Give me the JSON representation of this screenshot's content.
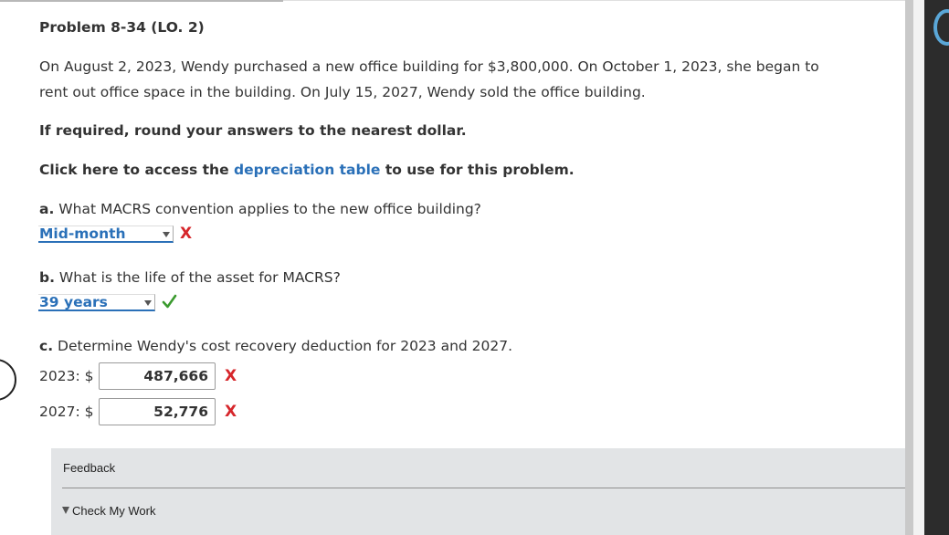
{
  "problem": {
    "title": "Problem 8-34 (LO. 2)",
    "intro_line1": "On August 2, 2023, Wendy purchased a new office building for $3,800,000. On October 1, 2023, she began to",
    "intro_line2": "rent out office space in the building. On July 15, 2027, Wendy sold the office building.",
    "rounding_note": "If required, round your answers to the nearest dollar.",
    "click_prefix": "Click here to access the",
    "link_text": "depreciation table",
    "click_suffix": "to use for this problem."
  },
  "part_a": {
    "letter": "a.",
    "question": "What MACRS convention applies to the new office building?",
    "selected": "Mid-month",
    "result": "X"
  },
  "part_b": {
    "letter": "b.",
    "question": "What is the life of the asset for MACRS?",
    "selected": "39 years",
    "result": "✓"
  },
  "part_c": {
    "letter": "c.",
    "question": "Determine Wendy's cost recovery deduction for 2023 and 2027.",
    "rows": [
      {
        "label": "2023: $",
        "value": "487,666",
        "result": "X"
      },
      {
        "label": "2027: $",
        "value": "52,776",
        "result": "X"
      }
    ]
  },
  "feedback": {
    "label": "Feedback",
    "check_my_work": "Check My Work"
  },
  "colors": {
    "link": "#2a70b8",
    "incorrect": "#d6262b",
    "correct": "#3a9a2e",
    "feedback_bg": "#e2e4e6"
  }
}
